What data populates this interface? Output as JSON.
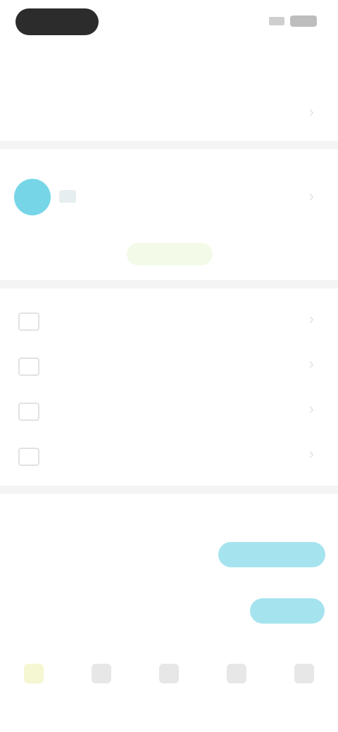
{
  "status": {
    "time": "",
    "icons": [
      "signal-icon",
      "battery-icon"
    ]
  },
  "header": {
    "title": ""
  },
  "device_section": {
    "title": "",
    "subtitle": ""
  },
  "members_section": {
    "title": "",
    "member_name": "",
    "add_label": ""
  },
  "menu": [
    {
      "icon": "calendar-icon",
      "label": ""
    },
    {
      "icon": "checklist-icon",
      "label": ""
    },
    {
      "icon": "settings-icon",
      "label": ""
    },
    {
      "icon": "message-icon",
      "label": ""
    }
  ],
  "mode_section": {
    "title": "",
    "segments": [
      "",
      "",
      ""
    ],
    "active_index": 2
  },
  "toggle_row": {
    "label": "",
    "value": "",
    "button_label": ""
  },
  "tabs": [
    {
      "icon": "home-icon",
      "label": ""
    },
    {
      "icon": "chart-icon",
      "label": ""
    },
    {
      "icon": "device-icon",
      "label": ""
    },
    {
      "icon": "bell-icon",
      "label": ""
    },
    {
      "icon": "user-icon",
      "label": ""
    }
  ],
  "colors": {
    "accent": "#a5e3ef",
    "avatar": "#76d6e8",
    "add_button": "#f3fbe8"
  }
}
